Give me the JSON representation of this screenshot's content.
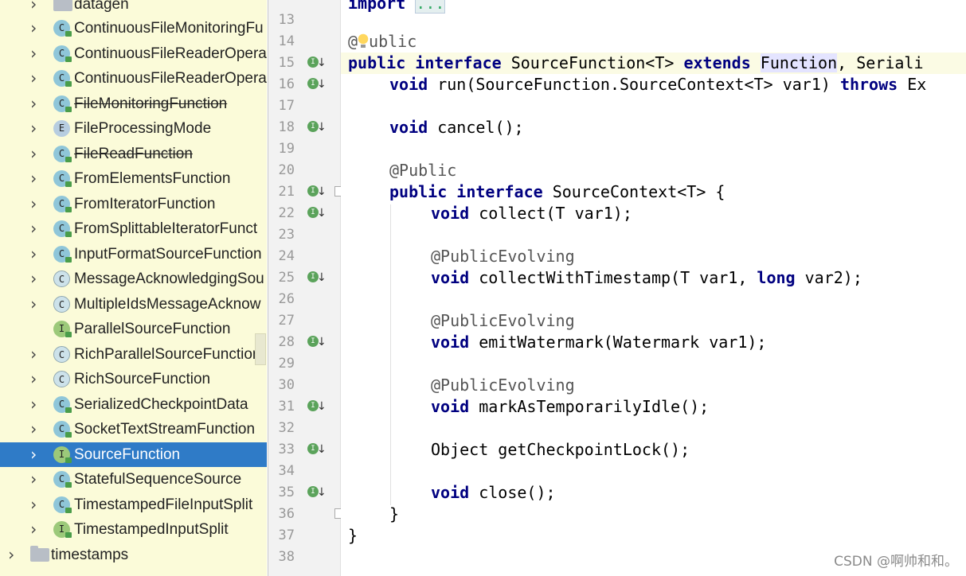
{
  "project_tree": {
    "items": [
      {
        "label": "datagen",
        "kind": "package",
        "strike": false
      },
      {
        "label": "ContinuousFileMonitoringFu",
        "kind": "class",
        "strike": false
      },
      {
        "label": "ContinuousFileReaderOpera",
        "kind": "class",
        "strike": false
      },
      {
        "label": "ContinuousFileReaderOpera",
        "kind": "class",
        "strike": false
      },
      {
        "label": "FileMonitoringFunction",
        "kind": "class",
        "strike": true
      },
      {
        "label": "FileProcessingMode",
        "kind": "enum",
        "strike": false
      },
      {
        "label": "FileReadFunction",
        "kind": "class",
        "strike": true
      },
      {
        "label": "FromElementsFunction",
        "kind": "class",
        "strike": false
      },
      {
        "label": "FromIteratorFunction",
        "kind": "class",
        "strike": false
      },
      {
        "label": "FromSplittableIteratorFunct",
        "kind": "class",
        "strike": false
      },
      {
        "label": "InputFormatSourceFunction",
        "kind": "class",
        "strike": false
      },
      {
        "label": "MessageAcknowledgingSou",
        "kind": "abstract",
        "strike": false
      },
      {
        "label": "MultipleIdsMessageAcknow",
        "kind": "abstract",
        "strike": false
      },
      {
        "label": "ParallelSourceFunction",
        "kind": "interface",
        "strike": false
      },
      {
        "label": "RichParallelSourceFunction",
        "kind": "abstract",
        "strike": false
      },
      {
        "label": "RichSourceFunction",
        "kind": "abstract",
        "strike": false
      },
      {
        "label": "SerializedCheckpointData",
        "kind": "class",
        "strike": false
      },
      {
        "label": "SocketTextStreamFunction",
        "kind": "class",
        "strike": false
      },
      {
        "label": "SourceFunction",
        "kind": "interface",
        "strike": false
      },
      {
        "label": "StatefulSequenceSource",
        "kind": "class",
        "strike": false
      },
      {
        "label": "TimestampedFileInputSplit",
        "kind": "class",
        "strike": false
      },
      {
        "label": "TimestampedInputSplit",
        "kind": "interface",
        "strike": false
      },
      {
        "label": "timestamps",
        "kind": "package",
        "strike": false
      }
    ],
    "selected": "SourceFunction"
  },
  "editor": {
    "line_numbers": [
      "13",
      "14",
      "15",
      "16",
      "17",
      "18",
      "19",
      "20",
      "21",
      "22",
      "23",
      "24",
      "25",
      "26",
      "27",
      "28",
      "29",
      "30",
      "31",
      "32",
      "33",
      "34",
      "35",
      "36",
      "37",
      "38"
    ],
    "top_fragment": {
      "kw": "import",
      "fold": "..."
    },
    "code": {
      "l14": {
        "at": "@",
        "rest": "ublic"
      },
      "l15": {
        "k1": "public",
        "k2": "interface",
        "t1": " SourceFunction<T> ",
        "k3": "extends",
        "sp": " ",
        "hl": "Function",
        "t2": ", Seriali"
      },
      "l16": {
        "k1": "void",
        "t1": " run(SourceFunction.SourceContext<T> var1) ",
        "k2": "throws",
        "t2": " Ex"
      },
      "l18": {
        "k1": "void",
        "t1": " cancel();"
      },
      "l20": {
        "a": "@Public"
      },
      "l21": {
        "k1": "public",
        "k2": "interface",
        "t1": " SourceContext<T> {"
      },
      "l22": {
        "k1": "void",
        "t1": " collect(T var1);"
      },
      "l24": {
        "a": "@PublicEvolving"
      },
      "l25": {
        "k1": "void",
        "t1": " collectWithTimestamp(T var1, ",
        "k2": "long",
        "t2": " var2);"
      },
      "l27": {
        "a": "@PublicEvolving"
      },
      "l28": {
        "k1": "void",
        "t1": " emitWatermark(Watermark var1);"
      },
      "l30": {
        "a": "@PublicEvolving"
      },
      "l31": {
        "k1": "void",
        "t1": " markAsTemporarilyIdle();"
      },
      "l33": {
        "t1": "Object getCheckpointLock();"
      },
      "l35": {
        "k1": "void",
        "t1": " close();"
      },
      "l36": {
        "t1": "}"
      },
      "l37": {
        "t1": "}"
      }
    }
  },
  "watermark": "CSDN @啊帅和和。"
}
